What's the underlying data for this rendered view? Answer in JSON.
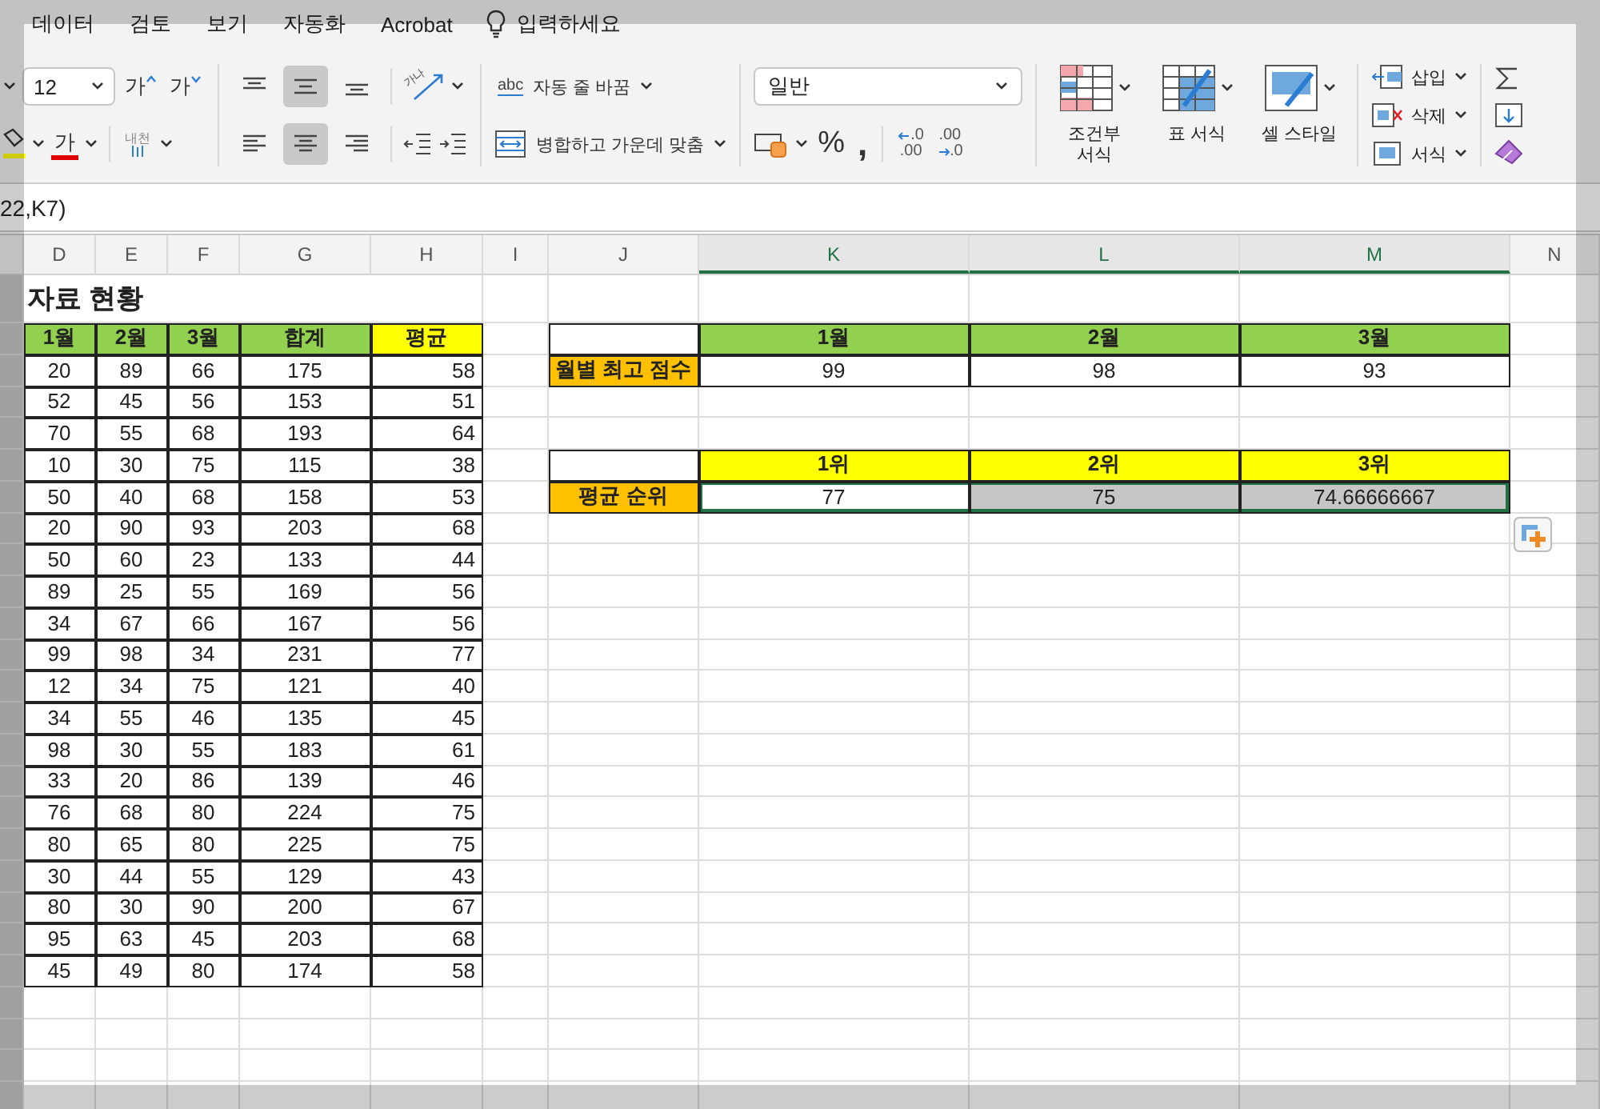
{
  "menu": [
    {
      "label": "데이터"
    },
    {
      "label": "검토"
    },
    {
      "label": "보기"
    },
    {
      "label": "자동화"
    },
    {
      "label": "Acrobat"
    }
  ],
  "tell_me": "입력하세요",
  "ribbon": {
    "font_size": "12",
    "grow_font": "가",
    "shrink_font": "가",
    "font_color": "가",
    "phonetic": "내천",
    "vertical_align": [
      {
        "selected": false
      },
      {
        "selected": true
      },
      {
        "selected": false
      }
    ],
    "horizontal_align": [
      {
        "selected": false
      },
      {
        "selected": true
      },
      {
        "selected": false
      }
    ],
    "orientation_icon_text": "가나",
    "wrap_text": {
      "icon_text": "abc",
      "label": "자동 줄 바꿈"
    },
    "merge_center": "병합하고 가운데 맞춤",
    "number_format": "일반",
    "percent": "%",
    "comma": ",",
    "decimals": [
      {
        "kind": "increase",
        "top": ".0",
        "bottom": ".00"
      },
      {
        "kind": "decrease",
        "top": ".00",
        "bottom": ".0"
      }
    ],
    "styles": [
      {
        "kind": "conditional",
        "label": "조건부 서식"
      },
      {
        "kind": "table",
        "label": "표 서식"
      },
      {
        "kind": "cell",
        "label": "셀 스타일"
      }
    ],
    "cells": [
      {
        "kind": "insert",
        "label": "삽입"
      },
      {
        "kind": "delete",
        "label": "삭제"
      },
      {
        "kind": "format",
        "label": "서식"
      }
    ]
  },
  "formula": "22,K7)",
  "columns": [
    {
      "label": "D",
      "selected": false
    },
    {
      "label": "E",
      "selected": false
    },
    {
      "label": "F",
      "selected": false
    },
    {
      "label": "G",
      "selected": false
    },
    {
      "label": "H",
      "selected": false
    },
    {
      "label": "I",
      "selected": false
    },
    {
      "label": "J",
      "selected": false
    },
    {
      "label": "K",
      "selected": true
    },
    {
      "label": "L",
      "selected": true
    },
    {
      "label": "M",
      "selected": true
    },
    {
      "label": "N",
      "selected": false
    }
  ],
  "title": "자료 현황",
  "score_table": {
    "header": [
      {
        "label": "1월",
        "color": "#92d050"
      },
      {
        "label": "2월",
        "color": "#92d050"
      },
      {
        "label": "3월",
        "color": "#92d050"
      },
      {
        "label": "합계",
        "color": "#92d050"
      },
      {
        "label": "평균",
        "color": "#ffff00"
      }
    ],
    "rows": [
      [
        "20",
        "89",
        "66",
        "175",
        "58"
      ],
      [
        "52",
        "45",
        "56",
        "153",
        "51"
      ],
      [
        "70",
        "55",
        "68",
        "193",
        "64"
      ],
      [
        "10",
        "30",
        "75",
        "115",
        "38"
      ],
      [
        "50",
        "40",
        "68",
        "158",
        "53"
      ],
      [
        "20",
        "90",
        "93",
        "203",
        "68"
      ],
      [
        "50",
        "60",
        "23",
        "133",
        "44"
      ],
      [
        "89",
        "25",
        "55",
        "169",
        "56"
      ],
      [
        "34",
        "67",
        "66",
        "167",
        "56"
      ],
      [
        "99",
        "98",
        "34",
        "231",
        "77"
      ],
      [
        "12",
        "34",
        "75",
        "121",
        "40"
      ],
      [
        "34",
        "55",
        "46",
        "135",
        "45"
      ],
      [
        "98",
        "30",
        "55",
        "183",
        "61"
      ],
      [
        "33",
        "20",
        "86",
        "139",
        "46"
      ],
      [
        "76",
        "68",
        "80",
        "224",
        "75"
      ],
      [
        "80",
        "65",
        "80",
        "225",
        "75"
      ],
      [
        "30",
        "44",
        "55",
        "129",
        "43"
      ],
      [
        "80",
        "30",
        "90",
        "200",
        "67"
      ],
      [
        "95",
        "63",
        "45",
        "203",
        "68"
      ],
      [
        "45",
        "49",
        "80",
        "174",
        "58"
      ]
    ]
  },
  "monthly_max": {
    "header": [
      {
        "label": "1월",
        "color": "#92d050"
      },
      {
        "label": "2월",
        "color": "#92d050"
      },
      {
        "label": "3월",
        "color": "#92d050"
      }
    ],
    "row_label": {
      "text": "월별 최고 점수",
      "color": "#ffc000"
    },
    "values": [
      "99",
      "98",
      "93"
    ]
  },
  "average_rank": {
    "header": [
      {
        "label": "1위",
        "color": "#ffff00"
      },
      {
        "label": "2위",
        "color": "#ffff00"
      },
      {
        "label": "3위",
        "color": "#ffff00"
      }
    ],
    "row_label": {
      "text": "평균 순위",
      "color": "#ffc000"
    },
    "cells": [
      {
        "value": "77",
        "selected": true,
        "active": true
      },
      {
        "value": "75",
        "selected": true,
        "active": false
      },
      {
        "value": "74.66666667",
        "selected": true,
        "active": false
      }
    ]
  }
}
